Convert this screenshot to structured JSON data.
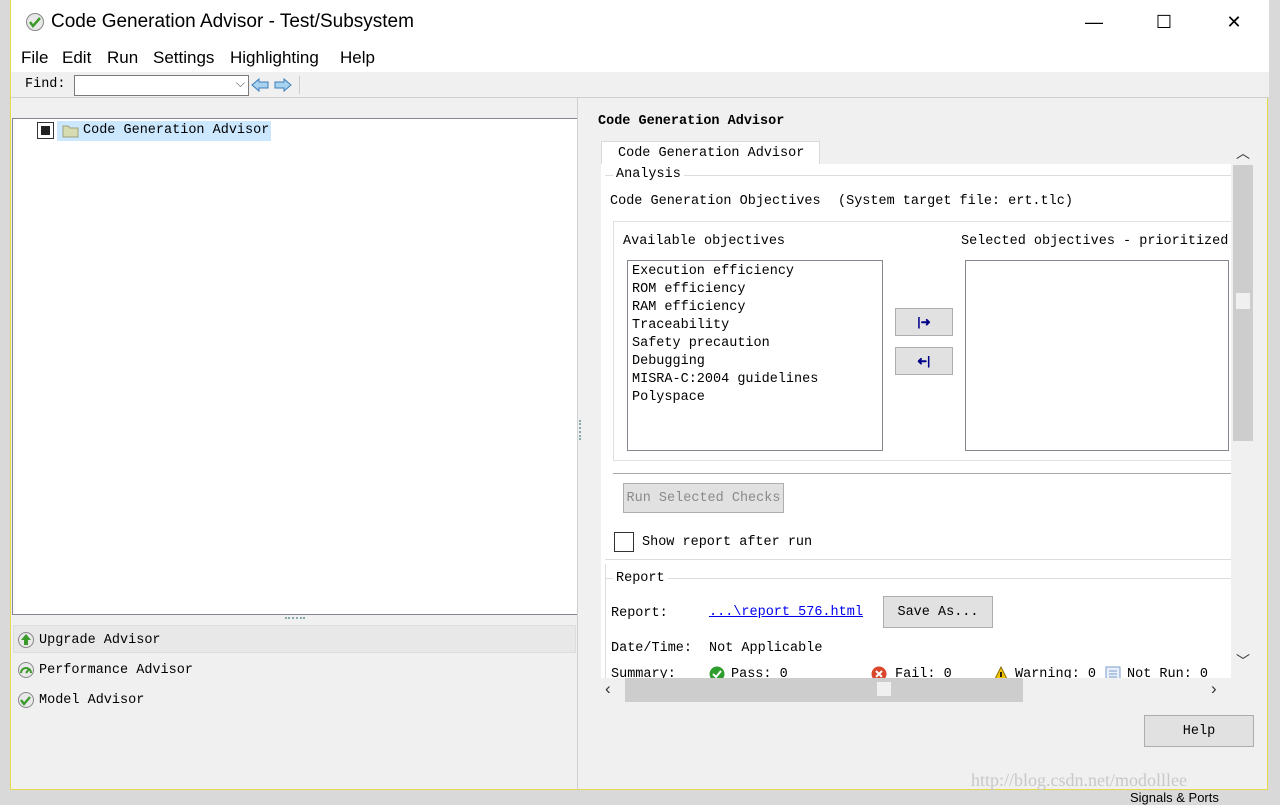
{
  "window": {
    "title": "Code Generation Advisor - Test/Subsystem",
    "minimize": "—",
    "maximize": "☐",
    "close": "✕"
  },
  "menu": [
    "File",
    "Edit",
    "Run",
    "Settings",
    "Highlighting",
    "Help"
  ],
  "toolbar": {
    "find_label": "Find:",
    "find_value": "",
    "back_icon": "arrow-left-icon",
    "forward_icon": "arrow-right-icon"
  },
  "tree": {
    "root_label": "Code Generation Advisor"
  },
  "advisors": [
    "Upgrade Advisor",
    "Performance Advisor",
    "Model Advisor"
  ],
  "panel": {
    "heading": "Code Generation Advisor",
    "tab": "Code Generation Advisor",
    "analysis": {
      "group_label": "Analysis",
      "objectives_label": "Code Generation Objectives",
      "target_file": "(System target file:  ert.tlc)",
      "available_label": "Available objectives",
      "selected_label": "Selected objectives - prioritized",
      "available": [
        "Execution efficiency",
        "ROM efficiency",
        "RAM efficiency",
        "Traceability",
        "Safety precaution",
        "Debugging",
        "MISRA-C:2004 guidelines",
        "Polyspace"
      ],
      "selected": [],
      "run_button": "Run Selected Checks",
      "show_report_label": "Show report after run",
      "show_report_checked": false
    },
    "report": {
      "group_label": "Report",
      "report_label": "Report:",
      "report_link": "...\\report_576.html",
      "save_as": "Save As...",
      "datetime_label": "Date/Time:",
      "datetime_value": "Not Applicable",
      "summary_label": "Summary:",
      "pass": "Pass: 0",
      "fail": "Fail: 0",
      "warning": "Warning: 0",
      "not_run": "Not Run: 0"
    }
  },
  "help_button": "Help",
  "watermark": "http://blog.csdn.net/modolllee",
  "background_app_text": "Signals & Ports",
  "colors": {
    "selection": "#cce8ff",
    "link": "#0000ee",
    "accent_arrow": "#00008b",
    "border": "#e6d94a"
  }
}
